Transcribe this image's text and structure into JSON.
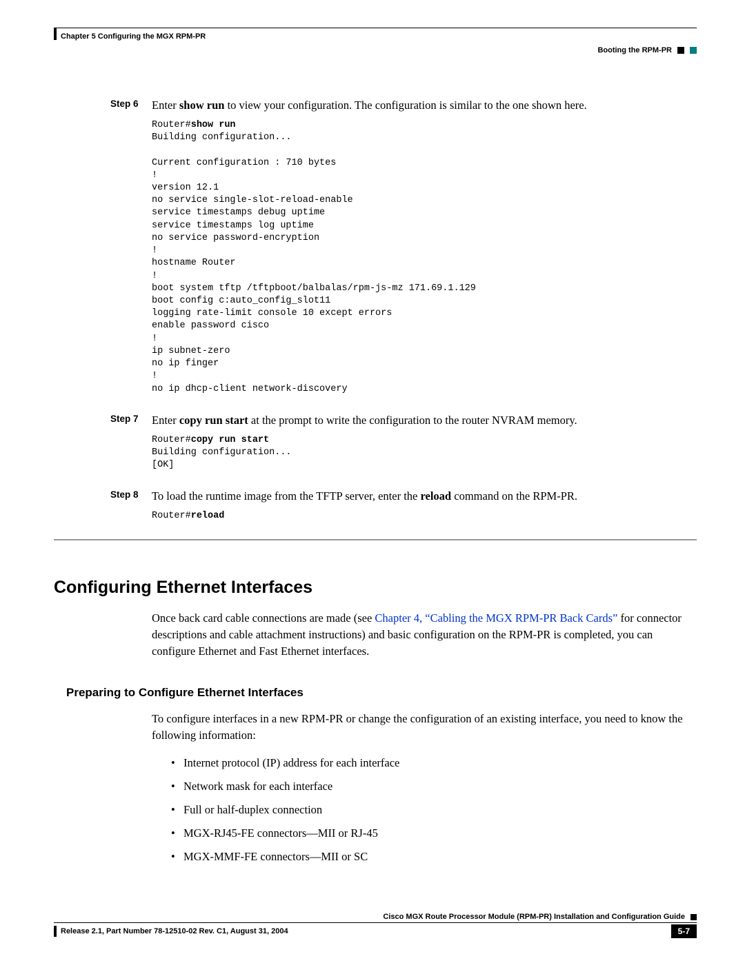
{
  "header": {
    "chapter": "Chapter 5    Configuring the MGX RPM-PR",
    "section": "Booting the RPM-PR"
  },
  "steps": {
    "s6": {
      "label": "Step 6",
      "text1": "Enter ",
      "bold1": "show run",
      "text2": " to view your configuration. The configuration is similar to the one shown here."
    },
    "s7": {
      "label": "Step 7",
      "text1": "Enter ",
      "bold1": "copy run start",
      "text2": " at the prompt to write the configuration to the router NVRAM memory."
    },
    "s8": {
      "label": "Step 8",
      "text1": "To load the runtime image from the TFTP server, enter the ",
      "bold1": "reload",
      "text2": " command on the RPM-PR."
    }
  },
  "code6": {
    "l0a": "Router#",
    "l0b": "show run",
    "l1": "Building configuration...",
    "l2": "",
    "l3": "Current configuration : 710 bytes",
    "l4": "!",
    "l5": "version 12.1",
    "l6": "no service single-slot-reload-enable",
    "l7": "service timestamps debug uptime",
    "l8": "service timestamps log uptime",
    "l9": "no service password-encryption",
    "l10": "!",
    "l11": "hostname Router",
    "l12": "!",
    "l13": "boot system tftp /tftpboot/balbalas/rpm-js-mz 171.69.1.129",
    "l14": "boot config c:auto_config_slot11",
    "l15": "logging rate-limit console 10 except errors",
    "l16": "enable password cisco",
    "l17": "!",
    "l18": "ip subnet-zero",
    "l19": "no ip finger",
    "l20": "!",
    "l21": "no ip dhcp-client network-discovery"
  },
  "code7": {
    "l0a": "Router#",
    "l0b": "copy run start",
    "l1": "Building configuration...",
    "l2": "[OK]"
  },
  "code8": {
    "l0a": "Router#",
    "l0b": "reload"
  },
  "section": {
    "title": "Configuring Ethernet Interfaces",
    "para1": "Once back card cable connections are made (see ",
    "link": "Chapter 4, “Cabling the MGX RPM-PR Back Cards”",
    "para2": " for connector descriptions and cable attachment instructions) and basic configuration on the RPM-PR is completed, you can configure Ethernet and Fast Ethernet interfaces."
  },
  "subsection": {
    "title": "Preparing to Configure Ethernet Interfaces",
    "para": "To configure interfaces in a new RPM-PR or change the configuration of an existing interface, you need to know the following information:",
    "b1": "Internet protocol (IP) address for each interface",
    "b2": "Network mask for each interface",
    "b3": "Full or half-duplex connection",
    "b4": "MGX-RJ45-FE connectors—MII or RJ-45",
    "b5": "MGX-MMF-FE connectors—MII or SC"
  },
  "footer": {
    "guide": "Cisco MGX Route Processor Module (RPM-PR) Installation and Configuration Guide",
    "release": "Release 2.1, Part Number 78-12510-02 Rev. C1, August 31, 2004",
    "pagenum": "5-7"
  }
}
